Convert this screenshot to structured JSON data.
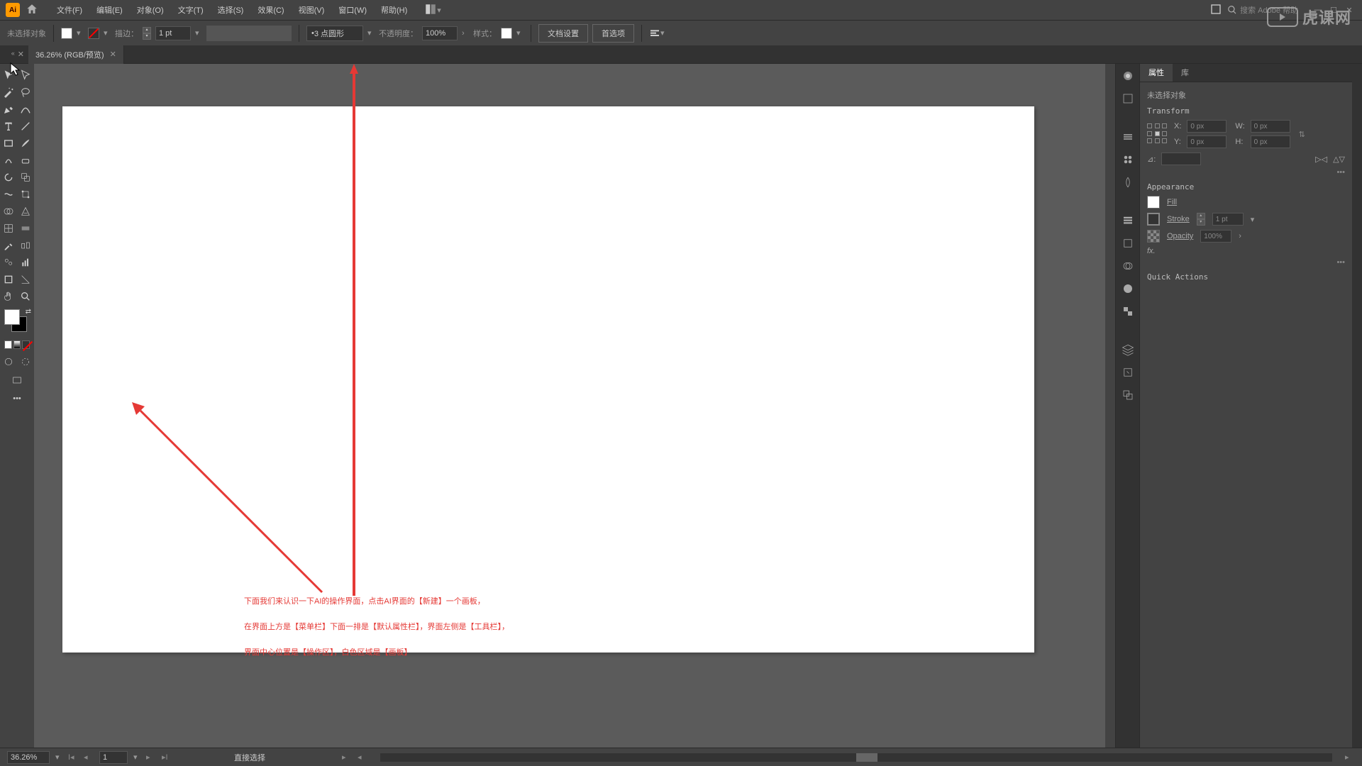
{
  "menubar": {
    "items": [
      "文件(F)",
      "编辑(E)",
      "对象(O)",
      "文字(T)",
      "选择(S)",
      "效果(C)",
      "视图(V)",
      "窗口(W)",
      "帮助(H)"
    ],
    "search_placeholder": "搜索 Adobe 帮助"
  },
  "propbar": {
    "no_selection": "未选择对象",
    "stroke_label": "描边：",
    "stroke_value": "1 pt",
    "brush_label": "3 点圆形",
    "opacity_label": "不透明度：",
    "opacity_value": "100%",
    "style_label": "样式：",
    "doc_setup": "文档设置",
    "prefs": "首选项"
  },
  "doc_tab": {
    "title": "36.26% (RGB/预览)"
  },
  "annotation": {
    "line1": "下面我们来认识一下AI的操作界面，点击AI界面的【新建】一个画板，",
    "line2": "在界面上方是【菜单栏】下面一排是【默认属性栏】，界面左侧是【工具栏】，",
    "line3": "界面中心位置是【操作区】，白色区域是【画板】"
  },
  "panels": {
    "tabs": {
      "properties": "属性",
      "library": "库"
    },
    "no_selection": "未选择对象",
    "transform": {
      "title": "Transform",
      "x_label": "X:",
      "y_label": "Y:",
      "w_label": "W:",
      "h_label": "H:",
      "x": "0 px",
      "y": "0 px",
      "w": "0 px",
      "h": "0 px",
      "angle_label": "⊿:"
    },
    "appearance": {
      "title": "Appearance",
      "fill": "Fill",
      "stroke": "Stroke",
      "stroke_val": "1 pt",
      "opacity": "Opacity",
      "opacity_val": "100%",
      "fx": "fx."
    },
    "quick_actions": "Quick Actions"
  },
  "statusbar": {
    "zoom": "36.26%",
    "page": "1",
    "tool_hint": "直接选择"
  },
  "watermark": "虎课网"
}
